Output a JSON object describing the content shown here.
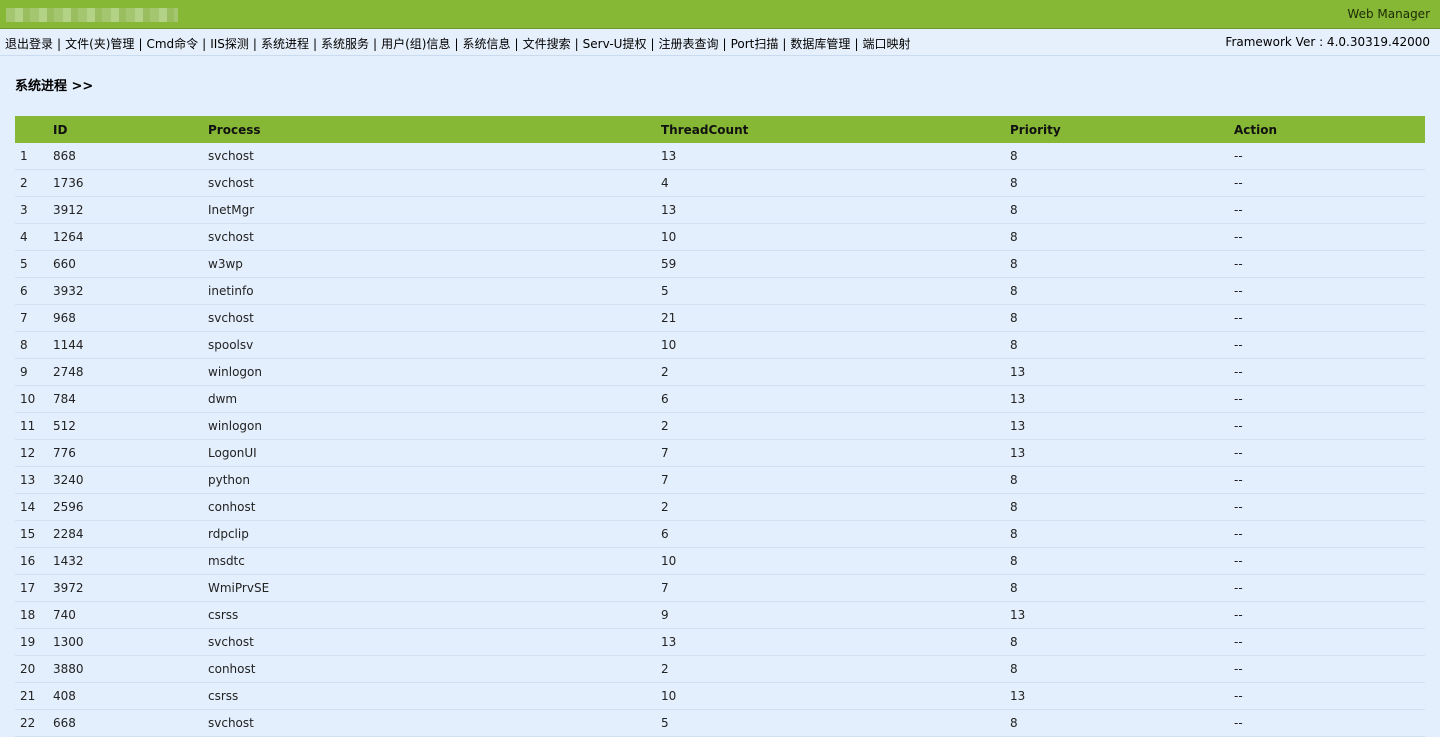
{
  "topbar": {
    "host": "",
    "brand": "Web Manager"
  },
  "nav": {
    "links": [
      "退出登录",
      "文件(夹)管理",
      "Cmd命令",
      "IIS探测",
      "系统进程",
      "系统服务",
      "用户(组)信息",
      "系统信息",
      "文件搜索",
      "Serv-U提权",
      "注册表查询",
      "Port扫描",
      "数据库管理",
      "端口映射"
    ],
    "framework": "Framework Ver : 4.0.30319.42000"
  },
  "page": {
    "title": "系统进程 >>"
  },
  "table": {
    "headers": [
      "",
      "ID",
      "Process",
      "ThreadCount",
      "Priority",
      "Action"
    ],
    "rows": [
      [
        "1",
        "868",
        "svchost",
        "13",
        "8",
        "--"
      ],
      [
        "2",
        "1736",
        "svchost",
        "4",
        "8",
        "--"
      ],
      [
        "3",
        "3912",
        "InetMgr",
        "13",
        "8",
        "--"
      ],
      [
        "4",
        "1264",
        "svchost",
        "10",
        "8",
        "--"
      ],
      [
        "5",
        "660",
        "w3wp",
        "59",
        "8",
        "--"
      ],
      [
        "6",
        "3932",
        "inetinfo",
        "5",
        "8",
        "--"
      ],
      [
        "7",
        "968",
        "svchost",
        "21",
        "8",
        "--"
      ],
      [
        "8",
        "1144",
        "spoolsv",
        "10",
        "8",
        "--"
      ],
      [
        "9",
        "2748",
        "winlogon",
        "2",
        "13",
        "--"
      ],
      [
        "10",
        "784",
        "dwm",
        "6",
        "13",
        "--"
      ],
      [
        "11",
        "512",
        "winlogon",
        "2",
        "13",
        "--"
      ],
      [
        "12",
        "776",
        "LogonUI",
        "7",
        "13",
        "--"
      ],
      [
        "13",
        "3240",
        "python",
        "7",
        "8",
        "--"
      ],
      [
        "14",
        "2596",
        "conhost",
        "2",
        "8",
        "--"
      ],
      [
        "15",
        "2284",
        "rdpclip",
        "6",
        "8",
        "--"
      ],
      [
        "16",
        "1432",
        "msdtc",
        "10",
        "8",
        "--"
      ],
      [
        "17",
        "3972",
        "WmiPrvSE",
        "7",
        "8",
        "--"
      ],
      [
        "18",
        "740",
        "csrss",
        "9",
        "13",
        "--"
      ],
      [
        "19",
        "1300",
        "svchost",
        "13",
        "8",
        "--"
      ],
      [
        "20",
        "3880",
        "conhost",
        "2",
        "8",
        "--"
      ],
      [
        "21",
        "408",
        "csrss",
        "10",
        "13",
        "--"
      ],
      [
        "22",
        "668",
        "svchost",
        "5",
        "8",
        "--"
      ]
    ]
  },
  "colors": {
    "accent": "#86b835",
    "background": "#e4effd"
  }
}
